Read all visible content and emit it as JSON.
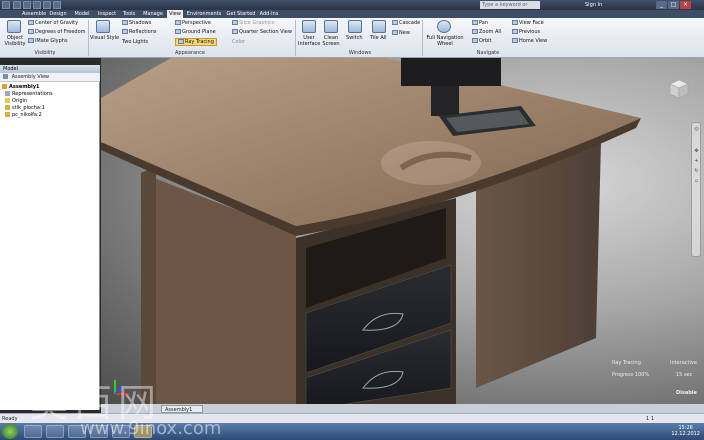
{
  "titlebar": {
    "search_placeholder": "Type a keyword or phrase",
    "signin": "Sign In",
    "controls": [
      "_",
      "□",
      "×"
    ]
  },
  "tabs": [
    "Assemble",
    "Design",
    "Model",
    "Inspect",
    "Tools",
    "Manage",
    "View",
    "Environments",
    "Get Started",
    "Add-Ins"
  ],
  "active_tab": "View",
  "ribbon": {
    "visibility": {
      "object_visibility": "Object Visibility",
      "center_of_gravity": "Center of Gravity",
      "degrees_of_freedom": "Degrees of Freedom",
      "ifeature_glyphs": "iMate Glyphs",
      "panel": "Visibility"
    },
    "appearance": {
      "visual_style": "Visual Style",
      "shadows": "Shadows",
      "reflections": "Reflections",
      "lighting": "Two Lights",
      "perspective": "Perspective",
      "ground_plane": "Ground Plane",
      "ray_tracing": "Ray Tracing",
      "slice_graphics": "Slice Graphics",
      "quarter_section": "Quarter Section View",
      "color": "Color",
      "panel": "Appearance"
    },
    "windows": {
      "user_interface": "User Interface",
      "clean_screen": "Clean Screen",
      "switch": "Switch",
      "tile_all": "Tile All",
      "cascade": "Cascade",
      "new": "New",
      "panel": "Windows"
    },
    "navigate": {
      "full_nav_wheel": "Full Navigation Wheel",
      "pan": "Pan",
      "zoom_all": "Zoom All",
      "orbit": "Orbit",
      "view_face": "View Face",
      "previous": "Previous",
      "home_view": "Home View",
      "panel": "Navigate"
    }
  },
  "browser": {
    "header": "Model",
    "toolbar_label": "Assembly View",
    "items": [
      {
        "label": "Assembly1",
        "bold": true
      },
      {
        "label": "Representations"
      },
      {
        "label": "Origin"
      },
      {
        "label": "stik_plocha:1"
      },
      {
        "label": "pc_nikolfa:2"
      }
    ]
  },
  "viewport": {
    "ray_tracing_label": "Ray Tracing",
    "ray_tracing_mode": "Interactive",
    "progress_label": "Progress 100%",
    "progress_time": "15 sec",
    "disable_label": "Disable"
  },
  "doctabs": [
    "Assembly1"
  ],
  "status": {
    "left": "Ready",
    "right": "1    1"
  },
  "taskbar": {
    "time": "15:26",
    "date": "12.12.2012"
  },
  "watermark": {
    "cn": "莫西网",
    "url": "www.9inox.com"
  }
}
